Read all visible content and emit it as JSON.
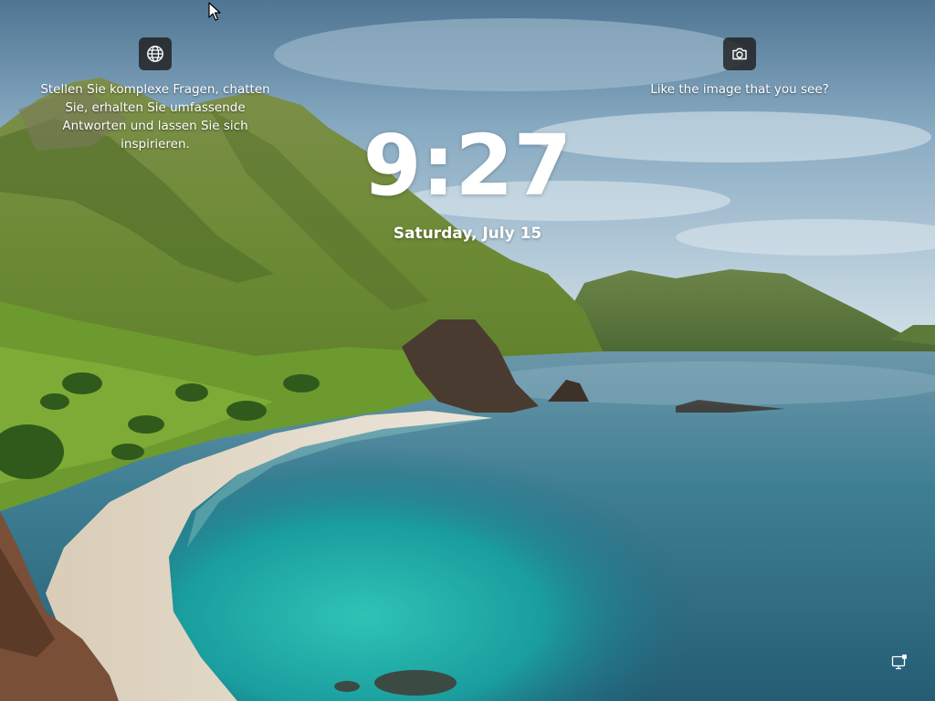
{
  "lock_screen": {
    "time": "9:27",
    "date": "Saturday, July 15"
  },
  "widgets": {
    "copilot": {
      "icon": "globe-icon",
      "lines": [
        "Stellen Sie komplexe Fragen, chatten",
        "Sie, erhalten Sie umfassende",
        "Antworten und lassen Sie sich",
        "inspirieren."
      ]
    },
    "spotlight": {
      "icon": "camera-icon",
      "text": "Like the image that you see?"
    }
  },
  "status": {
    "network_icon": "network-icon"
  },
  "colors": {
    "sky_top": "#5a7f9e",
    "sky_bottom": "#c9dbe6",
    "sea_turquoise": "#1fa7a6",
    "sea_deep": "#2d6e87",
    "hill_green": "#6f8d3a",
    "sand": "#e4dccd"
  }
}
